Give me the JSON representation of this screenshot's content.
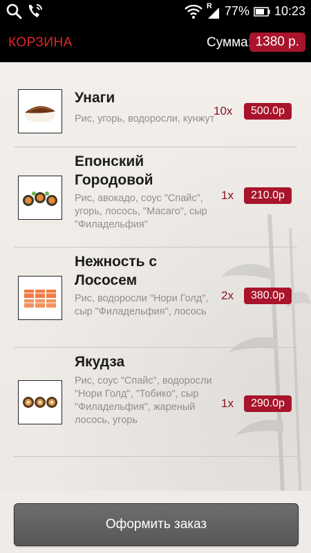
{
  "status_bar": {
    "battery": "77%",
    "time": "10:23",
    "signal_letter": "R"
  },
  "header": {
    "title": "КОРЗИНА",
    "sum_label": "Сумма:",
    "sum_value": "1380 р."
  },
  "items": [
    {
      "name": "Унаги",
      "description": "Рис, угорь, водоросли, кунжут",
      "qty": "10x",
      "price": "500.0р"
    },
    {
      "name": "Епонский Городовой",
      "description": "Рис, авокадо, соус \"Спайс\", угорь, лосось, \"Масаго\", сыр \"Филадельфия\"",
      "qty": "1x",
      "price": "210.0р"
    },
    {
      "name": "Нежность с Лососем",
      "description": "Рис, водоросли \"Нори Голд\", сыр \"Филадельфия\", лосось",
      "qty": "2x",
      "price": "380.0р"
    },
    {
      "name": "Якудза",
      "description": "Рис, соус \"Спайс\", водоросли \"Нори Голд\", \"Тобико\", сыр \"Филадельфия\", жареный лосось, угорь",
      "qty": "1x",
      "price": "290.0р"
    }
  ],
  "footer": {
    "order_button": "Оформить заказ"
  }
}
